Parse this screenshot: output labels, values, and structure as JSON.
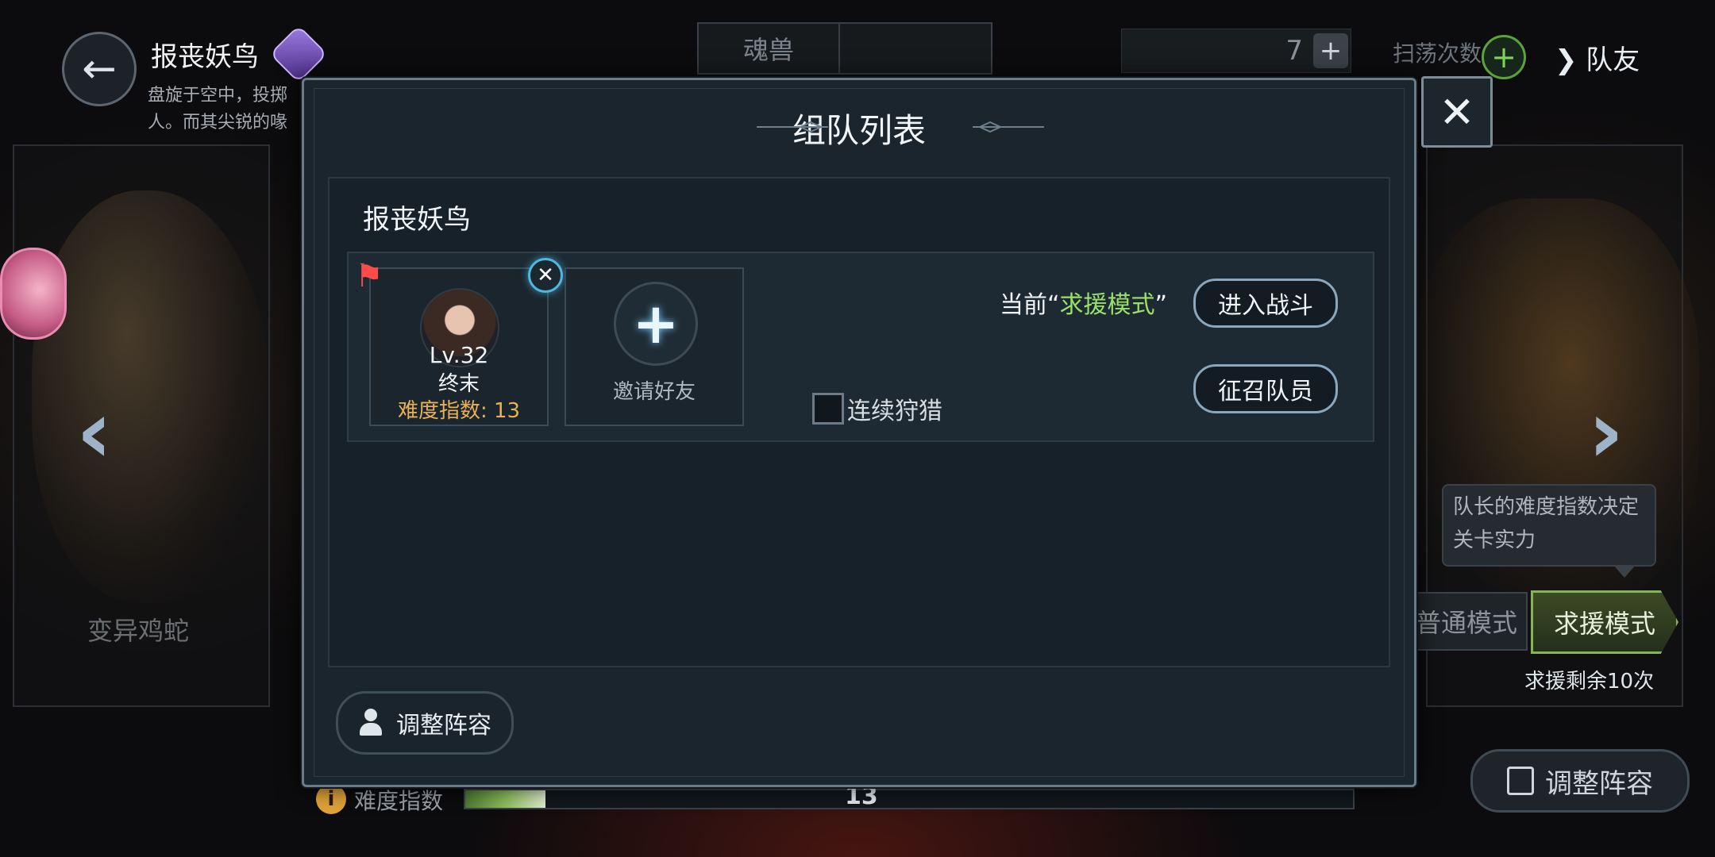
{
  "header": {
    "title": "报丧妖鸟",
    "description": "盘旋于空中，投掷\n人。而其尖锐的喙",
    "tabs": [
      "魂兽",
      ""
    ],
    "count_value": "7",
    "sweep_label": "扫荡次数",
    "team_label": "队友"
  },
  "side": {
    "left_beast_name": "变异鸡蛇",
    "tooltip": "队长的难度指数决定关卡实力",
    "mode_normal": "普通模式",
    "mode_help": "求援模式",
    "help_remaining": "求援剩余10次",
    "adjust_label": "调整阵容"
  },
  "difficulty": {
    "label": "难度指数",
    "value": "13",
    "fill_fraction": 0.09
  },
  "modal": {
    "title": "组队列表",
    "stage_name": "报丧妖鸟",
    "member": {
      "level": "Lv.32",
      "name": "终末",
      "difficulty": "难度指数: 13"
    },
    "invite_label": "邀请好友",
    "mode_prefix": "当前“",
    "mode_name": "求援模式",
    "mode_suffix": "”",
    "enter_battle": "进入战斗",
    "recruit": "征召队员",
    "continuous_hunt": "连续狩猎",
    "adjust_label": "调整阵容"
  },
  "icons": {
    "back": "arrow-left-icon",
    "close": "close-icon",
    "leader": "flag-icon",
    "remove": "remove-icon",
    "invite": "plus-icon",
    "adjust": "person-icon"
  },
  "colors": {
    "accent_green": "#9be06a",
    "difficulty_orange": "#e9b056",
    "modal_bg": "#1b252d"
  }
}
